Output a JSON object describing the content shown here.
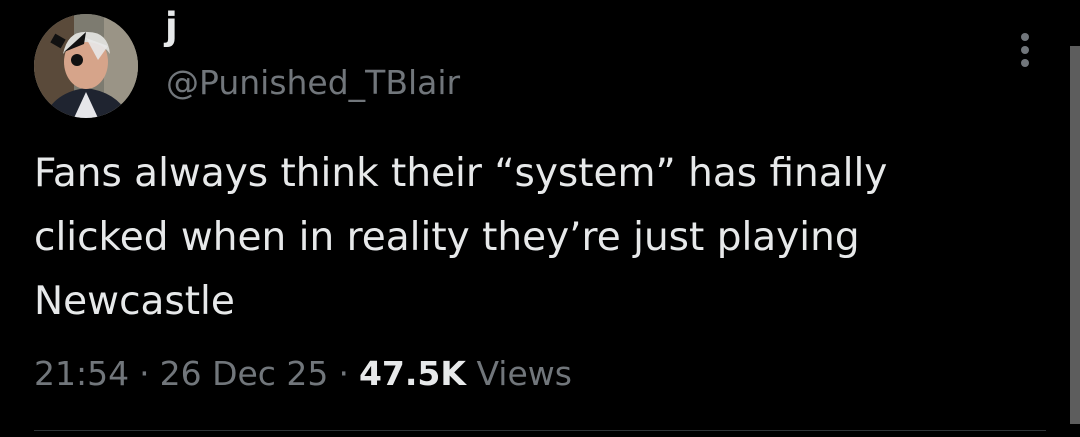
{
  "tweet": {
    "author": {
      "display_name": "j",
      "handle": "@Punished_TBlair",
      "avatar_icon": "profile-avatar"
    },
    "text": "Fans always think their “system” has finally\nclicked when in reality they’re just playing\nNewcastle",
    "time": "21:54",
    "date": "26 Dec 25",
    "views_count": "47.5K",
    "views_label": "Views",
    "more_icon": "more-vertical-icon"
  },
  "colors": {
    "background": "#000000",
    "primary_text": "#e7e9ea",
    "secondary_text": "#71767b"
  }
}
